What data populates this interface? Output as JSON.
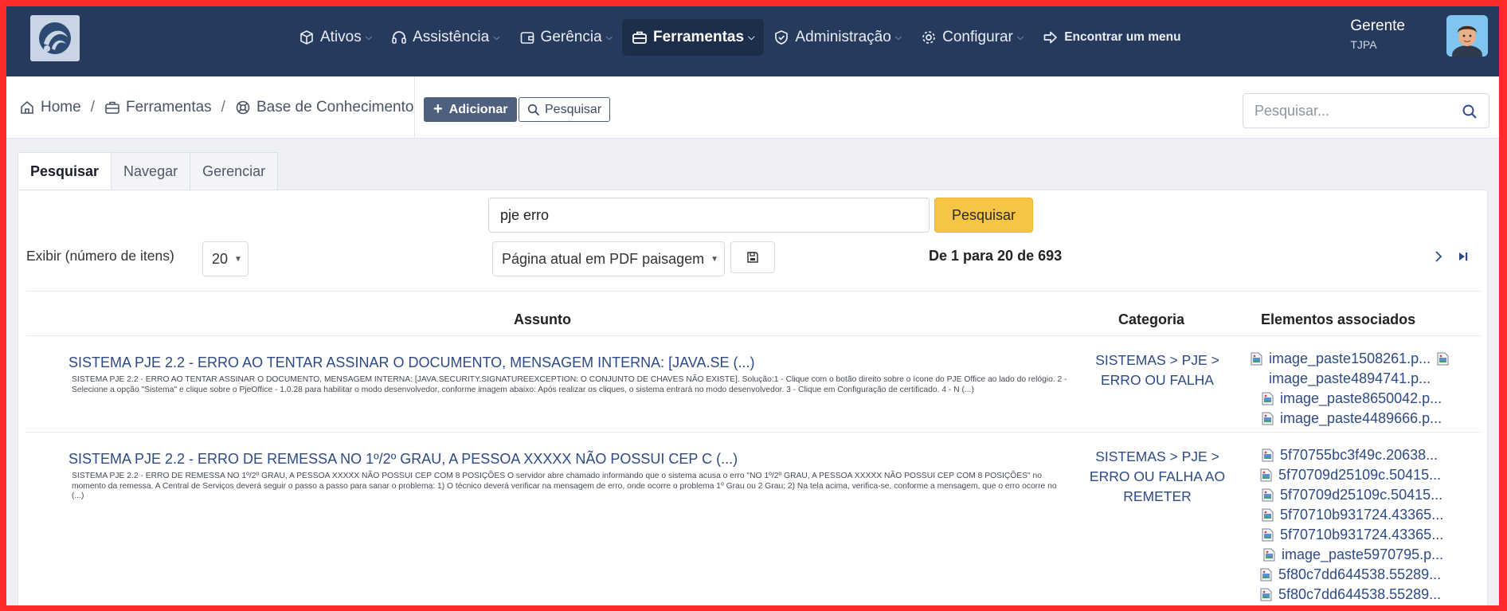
{
  "navbar": {
    "items": [
      {
        "label": "Ativos",
        "icon": "box-icon"
      },
      {
        "label": "Assistência",
        "icon": "headset-icon"
      },
      {
        "label": "Gerência",
        "icon": "wallet-icon"
      },
      {
        "label": "Ferramentas",
        "icon": "briefcase-icon"
      },
      {
        "label": "Administração",
        "icon": "shield-icon"
      },
      {
        "label": "Configurar",
        "icon": "gear-icon"
      }
    ],
    "find_menu": "Encontrar um menu",
    "user_name": "Gerente",
    "user_entity": "TJPA"
  },
  "breadcrumb": {
    "home": "Home",
    "tools": "Ferramentas",
    "kb": "Base de Conhecimento"
  },
  "toolbar": {
    "add_label": "Adicionar",
    "search_label": "Pesquisar"
  },
  "global_search": {
    "placeholder": "Pesquisar..."
  },
  "tabs": [
    "Pesquisar",
    "Navegar",
    "Gerenciar"
  ],
  "search": {
    "query": "pje erro",
    "button": "Pesquisar"
  },
  "list_controls": {
    "show_label": "Exibir (número de itens)",
    "per_page": "20",
    "export_option": "Página atual em PDF paisagem",
    "pagination_text": "De 1 para 20 de 693"
  },
  "table": {
    "headers": {
      "subject": "Assunto",
      "category": "Categoria",
      "attachments": "Elementos associados"
    },
    "rows": [
      {
        "title": "SISTEMA PJE 2.2 - ERRO AO TENTAR ASSINAR O DOCUMENTO, MENSAGEM INTERNA: [JAVA.SE (...)",
        "snippet": "SISTEMA PJE 2.2 - ERRO AO TENTAR ASSINAR O DOCUMENTO, MENSAGEM INTERNA: [JAVA.SECURITY.SIGNATUREEXCEPTION: O CONJUNTO DE CHAVES NÃO EXISTE].     Solução:1 - Clique com o botão direito sobre o ícone do PJE Office ao lado do relógio.   2 - Selecione a opção \"Sistema\" e clique sobre o PjeOffice - 1.0.28 para habilitar o modo desenvolvedor, conforme imagem abaixo: Após realizar os cliques, o sistema entrará no modo desenvolvedor.   3 - Clique em Configuração de certificado. 4 -  N (...)",
        "category": [
          "SISTEMAS > PJE >",
          "ERRO OU FALHA"
        ],
        "attachments": [
          "image_paste1508261.p...",
          "image_paste4894741.p...",
          "image_paste8650042.p...",
          "image_paste4489666.p..."
        ]
      },
      {
        "title": "SISTEMA PJE 2.2 - ERRO DE REMESSA NO 1º/2º GRAU, A PESSOA XXXXX NÃO POSSUI CEP C (...)",
        "snippet": "SISTEMA PJE 2.2 - ERRO DE REMESSA NO 1º/2º GRAU, A PESSOA XXXXX NÃO POSSUI CEP COM 8 POSIÇÕES O servidor abre chamado informando que o sistema acusa o erro \"NO 1º/2º GRAU, A PESSOA XXXXX NÃO POSSUI CEP COM 8 POSIÇÕES\" no momento da remessa.     A Central de Serviços deverá seguir o passo a passo para sanar o problema: 1) O técnico deverá verificar na mensagem de erro, onde ocorre o problema 1º Grau ou 2 Grau; 2) Na tela acima, verifica-se, conforme a mensagem, que o erro ocorre no (...)",
        "category": [
          "SISTEMAS > PJE >",
          "ERRO OU FALHA AO",
          "REMETER"
        ],
        "attachments": [
          "5f70755bc3f49c.20638...",
          "5f70709d25109c.50415...",
          "5f70709d25109c.50415...",
          "5f70710b931724.43365...",
          "5f70710b931724.43365...",
          "image_paste5970795.p...",
          "5f80c7dd644538.55289...",
          "5f80c7dd644538.55289..."
        ]
      }
    ]
  },
  "colors": {
    "navbar": "#263a5e",
    "link": "#2d4a86",
    "primary_button": "#f7c546",
    "frame_border": "#ff2a2a"
  }
}
